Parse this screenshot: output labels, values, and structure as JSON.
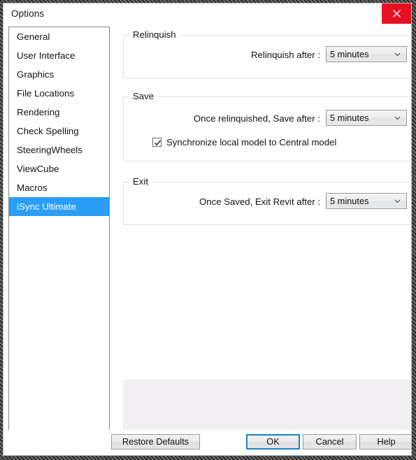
{
  "window": {
    "title": "Options",
    "close_icon": "close-icon",
    "accent_color": "#2a9df4",
    "close_color": "#e81123",
    "default_button_border": "#1783c7"
  },
  "sidebar": {
    "items": [
      {
        "label": "General",
        "selected": false
      },
      {
        "label": "User Interface",
        "selected": false
      },
      {
        "label": "Graphics",
        "selected": false
      },
      {
        "label": "File Locations",
        "selected": false
      },
      {
        "label": "Rendering",
        "selected": false
      },
      {
        "label": "Check Spelling",
        "selected": false
      },
      {
        "label": "SteeringWheels",
        "selected": false
      },
      {
        "label": "ViewCube",
        "selected": false
      },
      {
        "label": "Macros",
        "selected": false
      },
      {
        "label": "iSync Ultimate",
        "selected": true
      }
    ]
  },
  "groups": {
    "relinquish": {
      "legend": "Relinquish",
      "field_label": "Relinquish after :",
      "combo_value": "5 minutes",
      "combo_icon": "chevron-down-icon"
    },
    "save": {
      "legend": "Save",
      "field_label": "Once relinquished,  Save after :",
      "combo_value": "5 minutes",
      "combo_icon": "chevron-down-icon",
      "checkbox_label": "Synchronize  local model to Central model",
      "checkbox_checked": "checked"
    },
    "exit": {
      "legend": "Exit",
      "field_label": "Once Saved, Exit Revit after :",
      "combo_value": "5 minutes",
      "combo_icon": "chevron-down-icon"
    }
  },
  "footer": {
    "restore_label": "Restore Defaults",
    "ok_label": "OK",
    "cancel_label": "Cancel",
    "help_label": "Help"
  }
}
